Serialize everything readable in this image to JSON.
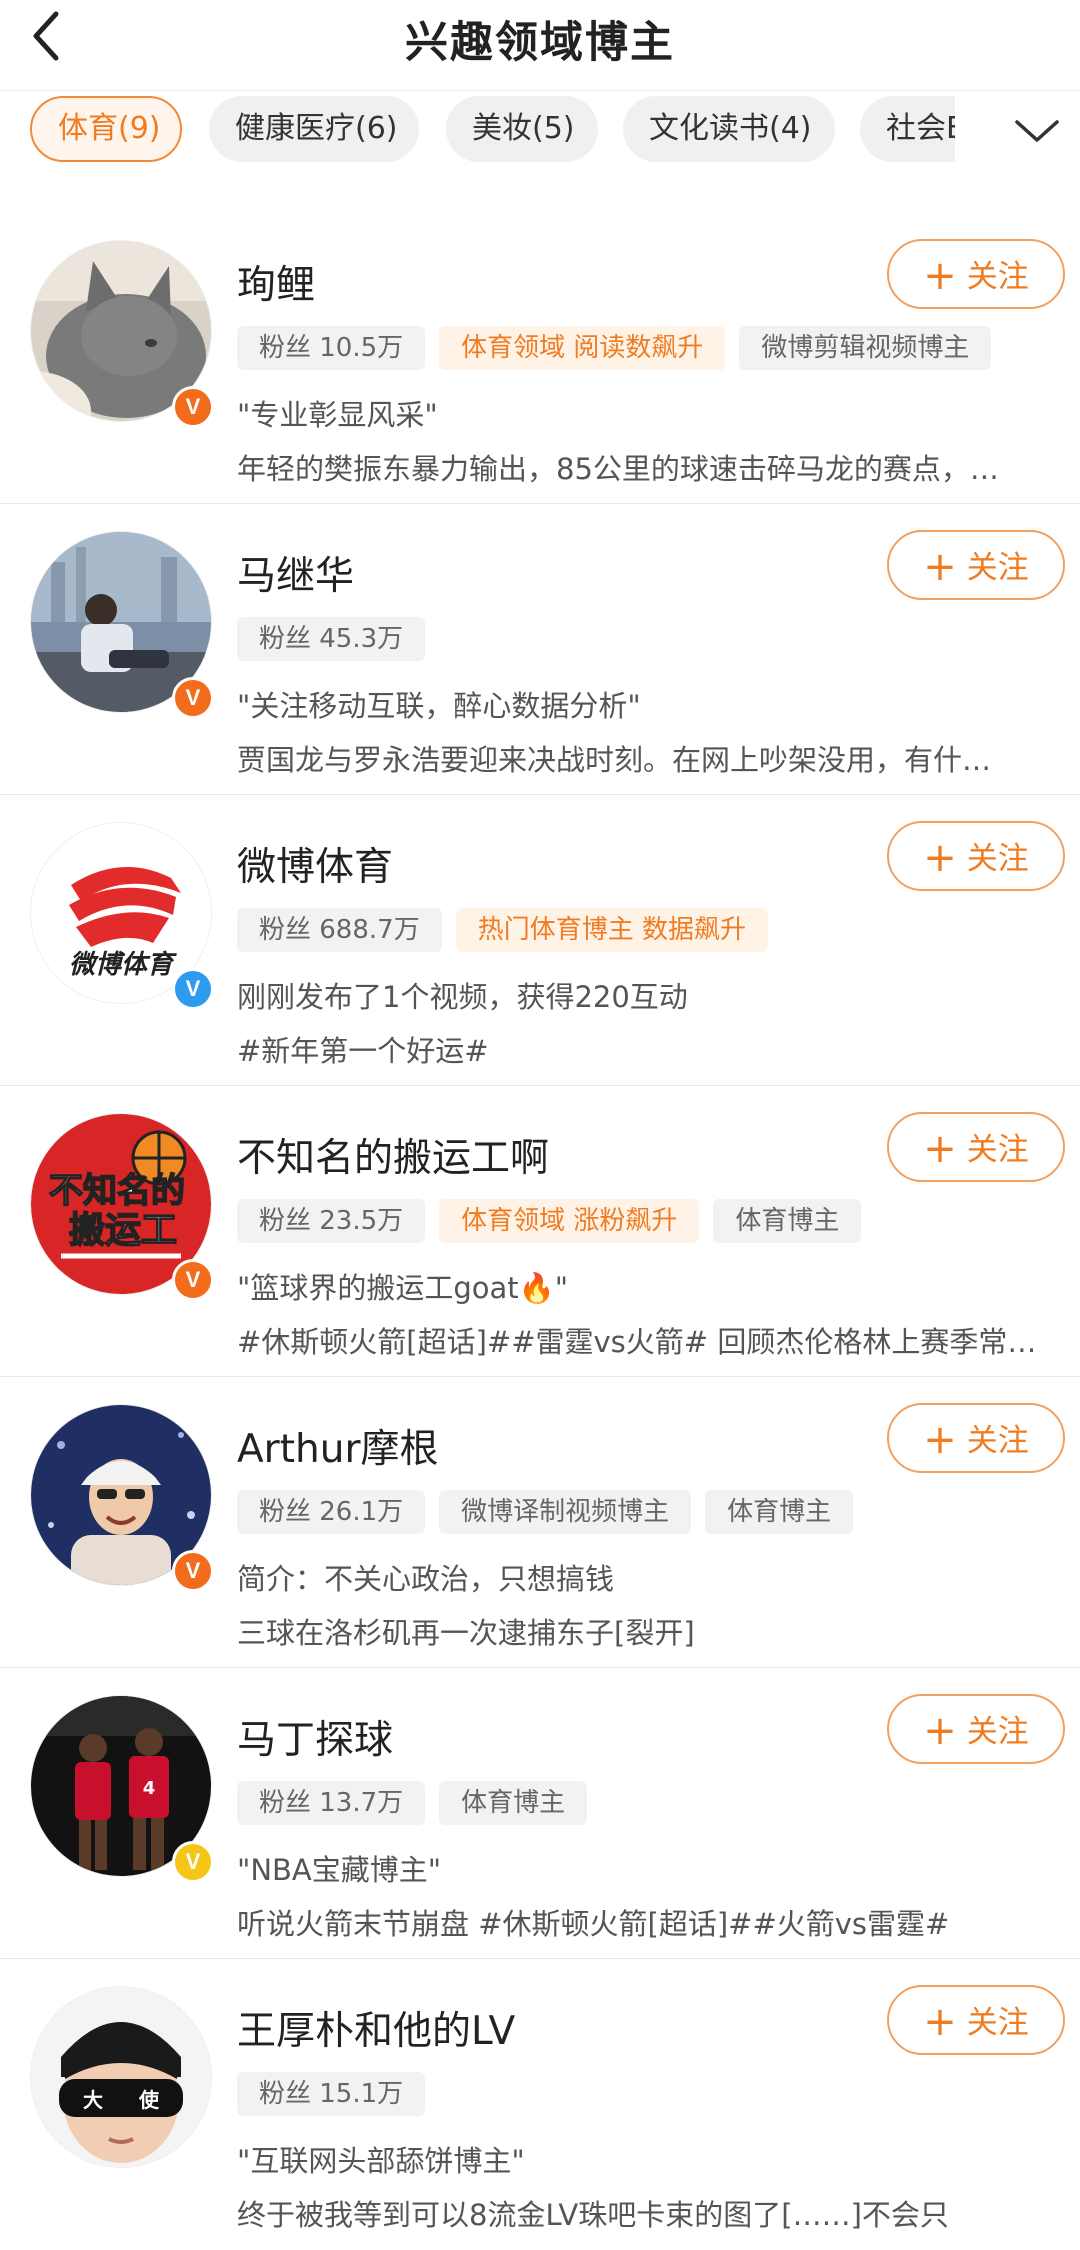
{
  "header": {
    "title": "兴趣领域博主",
    "back_icon": "chevron-left-icon"
  },
  "tabs": [
    {
      "label": "体育(9)",
      "active": true
    },
    {
      "label": "健康医疗(6)",
      "active": false
    },
    {
      "label": "美妆(5)",
      "active": false
    },
    {
      "label": "文化读书(4)",
      "active": false
    },
    {
      "label": "社会E",
      "active": false
    }
  ],
  "expand_icon": "chevron-down-icon",
  "follow_label": "关注",
  "colors": {
    "accent": "#f07c22",
    "badge_orange": "#f26c1c",
    "badge_blue": "#2d9cf0",
    "badge_yellow": "#f5c518"
  },
  "bloggers": [
    {
      "name": "珣鲤",
      "tags": [
        {
          "text": "粉丝 10.5万",
          "hot": false
        },
        {
          "text": "体育领域 阅读数飙升",
          "hot": true
        },
        {
          "text": "微博剪辑视频博主",
          "hot": false
        }
      ],
      "line1": "\"专业彰显风采\"",
      "line2": "年轻的樊振东暴力输出，85公里的球速击碎马龙的赛点，…",
      "badge": "orange",
      "avatar": "gray-cat"
    },
    {
      "name": "马继华",
      "tags": [
        {
          "text": "粉丝 45.3万",
          "hot": false
        }
      ],
      "line1": "\"关注移动互联，醉心数据分析\"",
      "line2": "贾国龙与罗永浩要迎来决战时刻。在网上吵架没用，有什…",
      "badge": "orange",
      "avatar": "man-by-window"
    },
    {
      "name": "微博体育",
      "tags": [
        {
          "text": "粉丝 688.7万",
          "hot": false
        },
        {
          "text": "热门体育博主 数据飙升",
          "hot": true
        }
      ],
      "line1": "刚刚发布了1个视频，获得220互动",
      "line2": "#新年第一个好运#",
      "badge": "blue",
      "avatar": "weibo-sports-logo",
      "avatar_text": "微博体育"
    },
    {
      "name": "不知名的搬运工啊",
      "tags": [
        {
          "text": "粉丝 23.5万",
          "hot": false
        },
        {
          "text": "体育领域 涨粉飙升",
          "hot": true
        },
        {
          "text": "体育博主",
          "hot": false
        }
      ],
      "line1": "\"篮球界的搬运工goat🔥\"",
      "line2": "#休斯顿火箭[超话]##雷霆vs火箭# 回顾杰伦格林上赛季常…",
      "badge": "orange",
      "avatar": "basketball-logo",
      "avatar_text_top": "不知名的",
      "avatar_text_bottom": "搬运工"
    },
    {
      "name": "Arthur摩根",
      "tags": [
        {
          "text": "粉丝 26.1万",
          "hot": false
        },
        {
          "text": "微博译制视频博主",
          "hot": false
        },
        {
          "text": "体育博主",
          "hot": false
        }
      ],
      "line1": "简介：不关心政治，只想搞钱",
      "line2": "三球在洛杉矶再一次逮捕东子[裂开]",
      "badge": "orange",
      "avatar": "man-with-cap"
    },
    {
      "name": "马丁探球",
      "tags": [
        {
          "text": "粉丝 13.7万",
          "hot": false
        },
        {
          "text": "体育博主",
          "hot": false
        }
      ],
      "line1": "\"NBA宝藏博主\"",
      "line2": "听说火箭末节崩盘 #休斯顿火箭[超话]##火箭vs雷霆#",
      "badge": "yellow",
      "avatar": "basketball-players"
    },
    {
      "name": "王厚朴和他的LV",
      "tags": [
        {
          "text": "粉丝 15.1万",
          "hot": false
        }
      ],
      "line1": "\"互联网头部舔饼博主\"",
      "line2": "终于被我等到可以8流金LV珠吧卡束的图了[……]不会只",
      "badge": "none",
      "avatar": "man-sunglasses",
      "avatar_text_left": "大",
      "avatar_text_right": "使"
    }
  ]
}
